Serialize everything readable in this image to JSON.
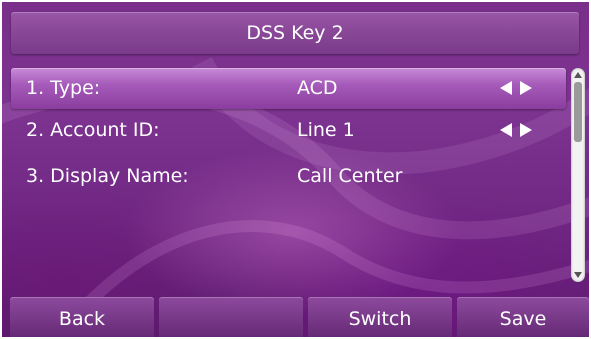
{
  "screen": {
    "title": "DSS Key 2"
  },
  "menu": {
    "items": [
      {
        "label": "1. Type:",
        "value": "ACD",
        "selected": true,
        "has_arrows": true
      },
      {
        "label": "2. Account ID:",
        "value": "Line 1",
        "selected": false,
        "has_arrows": true
      },
      {
        "label": "3. Display Name:",
        "value": "Call Center",
        "selected": false,
        "has_arrows": false
      }
    ]
  },
  "softkeys": [
    {
      "label": "Back"
    },
    {
      "label": ""
    },
    {
      "label": "Switch"
    },
    {
      "label": "Save"
    }
  ],
  "icons": {
    "left": "arrow-left-icon",
    "right": "arrow-right-icon",
    "scroll_up": "scroll-up-arrow-icon",
    "scroll_down": "scroll-down-arrow-icon"
  },
  "colors": {
    "background": "#7a2f8a",
    "selected_row": "#a65bba",
    "softkey": "#7a3a8a",
    "text": "#ffffff"
  }
}
